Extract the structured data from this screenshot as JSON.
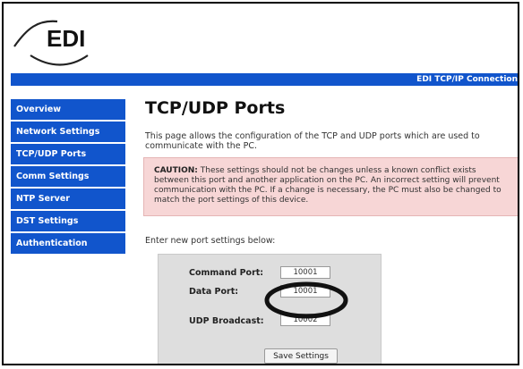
{
  "logo": {
    "text": "EDI"
  },
  "banner": {
    "text": "EDI TCP/IP Connection"
  },
  "sidebar": {
    "items": [
      {
        "label": "Overview"
      },
      {
        "label": "Network Settings"
      },
      {
        "label": "TCP/UDP Ports"
      },
      {
        "label": "Comm Settings"
      },
      {
        "label": "NTP Server"
      },
      {
        "label": "DST Settings"
      },
      {
        "label": "Authentication"
      }
    ]
  },
  "main": {
    "title": "TCP/UDP Ports",
    "intro": "This page allows the configuration of the TCP and UDP ports which are used to communicate with the PC.",
    "caution": {
      "label": "CAUTION:",
      "text": " These settings should not be changes unless a known conflict exists between this port and another application on the PC. An incorrect setting will prevent communication with the PC. If a change is necessary, the PC must also be changed to match the port settings of this device."
    },
    "prompt": "Enter new port settings below:",
    "form": {
      "command_port_label": "Command Port:",
      "command_port_value": "10001",
      "data_port_label": "Data Port:",
      "data_port_value": "10001",
      "udp_broadcast_label": "UDP Broadcast:",
      "udp_broadcast_value": "10002",
      "save_label": "Save Settings"
    }
  },
  "colors": {
    "nav_blue": "#1155cc",
    "caution_bg": "#f7d6d6",
    "panel_bg": "#dedede"
  }
}
